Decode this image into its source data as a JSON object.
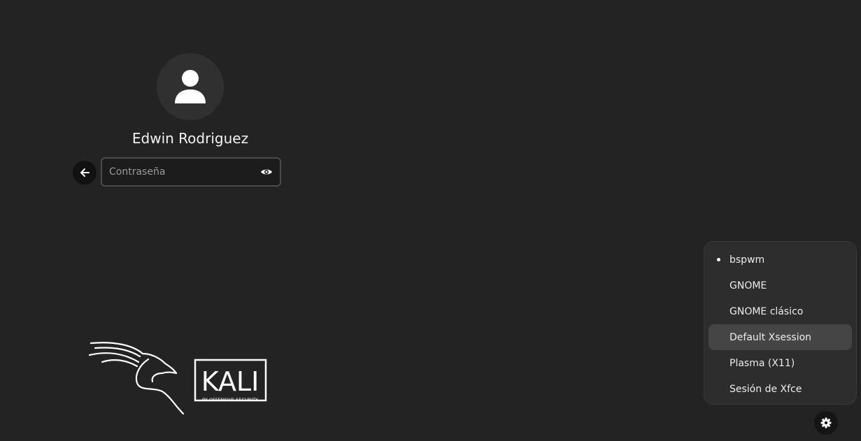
{
  "user": {
    "name": "Edwin Rodriguez"
  },
  "login": {
    "password_placeholder": "Contraseña",
    "password_value": ""
  },
  "logo": {
    "brand_text": "KALI",
    "tagline": "BY OFFENSIVE SECURITY"
  },
  "sessions": {
    "selected": "bspwm",
    "hovered": "Default Xsession",
    "items": [
      {
        "label": "bspwm"
      },
      {
        "label": "GNOME"
      },
      {
        "label": "GNOME clásico"
      },
      {
        "label": "Default Xsession"
      },
      {
        "label": "Plasma (X11)"
      },
      {
        "label": "Sesión de Xfce"
      }
    ]
  },
  "icons": {
    "avatar": "user-icon",
    "back": "arrow-left-icon",
    "reveal": "eye-icon",
    "settings": "gear-icon"
  },
  "colors": {
    "background": "#232323",
    "menu_background": "#2d2d2d",
    "menu_hover": "#454545"
  }
}
